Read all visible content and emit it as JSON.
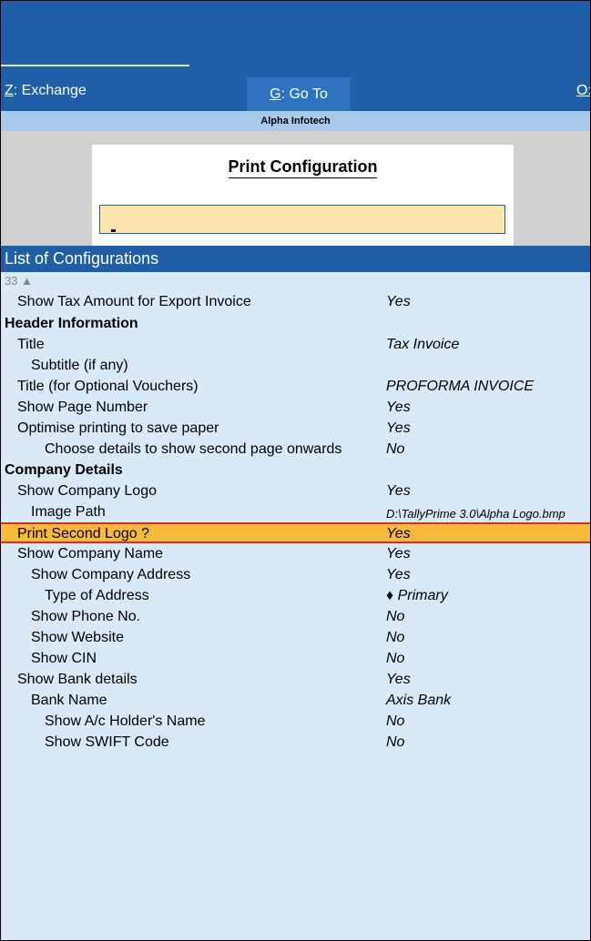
{
  "toolbar": {
    "exchange": {
      "key": "Z",
      "label": ": Exchange"
    },
    "goto": {
      "key": "G",
      "label": ": Go To"
    },
    "o_key": "O:"
  },
  "company": "Alpha Infotech",
  "dialog": {
    "title": "Print Configuration",
    "input_value": ""
  },
  "list_title": "List of Configurations",
  "scroll_count": "33 ▲",
  "rows": [
    {
      "label": "Show Tax Amount for Export Invoice",
      "value": "Yes"
    },
    {
      "label": "Header Information",
      "value": ""
    },
    {
      "label": "Title",
      "value": "Tax Invoice"
    },
    {
      "label": "Subtitle (if any)",
      "value": ""
    },
    {
      "label": "Title (for Optional Vouchers)",
      "value": "PROFORMA INVOICE"
    },
    {
      "label": "Show Page Number",
      "value": "Yes"
    },
    {
      "label": "Optimise printing to save paper",
      "value": "Yes"
    },
    {
      "label": "Choose details to show second page onwards",
      "value": "No"
    },
    {
      "label": "Company Details",
      "value": ""
    },
    {
      "label": "Show Company Logo",
      "value": "Yes"
    },
    {
      "label": "Image Path",
      "value": "D:\\TallyPrime 3.0\\Alpha Logo.bmp"
    },
    {
      "label": "Print Second Logo ?",
      "value": "Yes"
    },
    {
      "label": "Show Company Name",
      "value": "Yes"
    },
    {
      "label": "Show Company Address",
      "value": "Yes"
    },
    {
      "label": "Type of Address",
      "value": "♦ Primary"
    },
    {
      "label": "Show Phone No.",
      "value": "No"
    },
    {
      "label": "Show Website",
      "value": "No"
    },
    {
      "label": "Show CIN",
      "value": "No"
    },
    {
      "label": "Show Bank details",
      "value": "Yes"
    },
    {
      "label": "Bank Name",
      "value": "Axis Bank"
    },
    {
      "label": "Show A/c Holder's Name",
      "value": "No"
    },
    {
      "label": "Show SWIFT Code",
      "value": "No"
    }
  ],
  "colors": {
    "topbar": "#1f5fa8",
    "selection": "#f6b93b",
    "selection_border": "#d62e1f",
    "list_bg": "#d9e9f7"
  }
}
